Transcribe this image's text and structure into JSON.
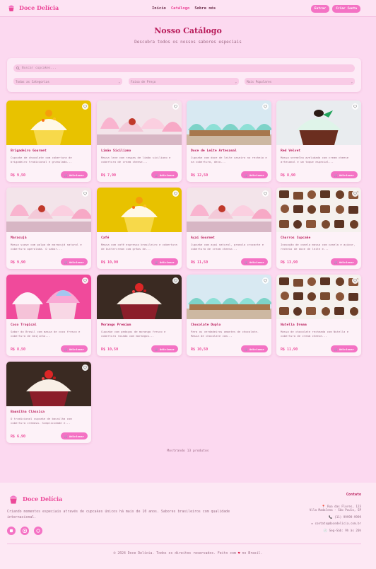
{
  "nav": {
    "brand": "Doce Delícia",
    "links": [
      "Início",
      "Catálogo",
      "Sobre nós"
    ],
    "login": "Entrar",
    "signup": "Criar Conta"
  },
  "page": {
    "title": "Nosso Catálogo",
    "subtitle": "Descubra todos os nossos sabores especiais"
  },
  "filters": {
    "search_placeholder": "Buscar cupcakes...",
    "category": "Todas as Categorias",
    "price": "Faixa de Preço",
    "sort": "Mais Populares"
  },
  "add_label": "Adicionar",
  "products": [
    {
      "name": "Brigadeiro Gourmet",
      "desc": "Cupcake de chocolate com cobertura de brigadeiro tradicional e granulado...",
      "price": "R$ 9,50",
      "img": "yellow"
    },
    {
      "name": "Limão Siciliano",
      "desc": "Massa leve com raspas de limão siciliano e cobertura de cream cheese...",
      "price": "R$ 7,90",
      "img": "pastel"
    },
    {
      "name": "Doce de Leite Artesanal",
      "desc": "Cupcake com doce de leite caseiro no recheio e na cobertura, deco...",
      "price": "R$ 12,50",
      "img": "teal"
    },
    {
      "name": "Red Velvet",
      "desc": "Massa vermelha aveludada com cream cheese artesanal e um toque especial...",
      "price": "R$ 8,90",
      "img": "velvet"
    },
    {
      "name": "Maracujá",
      "desc": "Massa suave com polpa de maracujá natural e cobertura aperolada. O sabor...",
      "price": "R$ 9,90",
      "img": "pastel"
    },
    {
      "name": "Café",
      "desc": "Massa com café espresso brasileiro e cobertura de buttercream com grãos de...",
      "price": "R$ 10,90",
      "img": "yellow"
    },
    {
      "name": "Açaí Gourmet",
      "desc": "Cupcake com açaí natural, granola crocante e cobertura de cream cheese...",
      "price": "R$ 11,50",
      "img": "pastel"
    },
    {
      "name": "Churros Cupcake",
      "desc": "Inovação de canela massa com canela e açúcar, recheio de doce de leite e...",
      "price": "R$ 13,90",
      "img": "choc"
    },
    {
      "name": "Coco Tropical",
      "desc": "Sabor do Brasil com massa de coco fresco e cobertura de beijinho...",
      "price": "R$ 8,50",
      "img": "pink"
    },
    {
      "name": "Morango Premium",
      "desc": "Cupcake com pedaços de morango fresco e cobertura rosada com morangos...",
      "price": "R$ 10,50",
      "img": "strawberry"
    },
    {
      "name": "Chocolate Duplo",
      "desc": "Para os verdadeiros amantes de chocolate. Massa de chocolate com...",
      "price": "R$ 10,50",
      "img": "teal"
    },
    {
      "name": "Nutella Dream",
      "desc": "Massa de chocolate recheada com Nutella e cobertura de cream cheese...",
      "price": "R$ 11,90",
      "img": "choc"
    },
    {
      "name": "Baunilha Clássica",
      "desc": "O tradicional cupcake de baunilha com cobertura cremosa. Simplicidade e...",
      "price": "R$ 6,90",
      "img": "strawberry"
    }
  ],
  "count_text": "Mostrando 13 produtos",
  "footer": {
    "brand": "Doce Delícia",
    "tagline": "Criando momentos especiais através de cupcakes únicos há mais de 10 anos. Sabores brasileiros com qualidade internacional.",
    "contact_title": "Contato",
    "address1": "Rua das Flores, 123",
    "address2": "Vila Madalena - São Paulo, SP",
    "phone": "(11) 99999-9999",
    "email": "contato@docedelicia.com.br",
    "hours": "Seg-Sáb: 9h às 20h",
    "copyright_pre": "© 2024 Doce Delícia. Todos os direitos reservados. Feito com",
    "copyright_post": "no Brasil."
  },
  "colors": {
    "accent": "#ec4899",
    "title": "#b91c5b",
    "background": "#fcd9f0"
  },
  "icons": {
    "heart": "heart-icon",
    "cart": "cart-icon",
    "search": "search-icon",
    "pin": "map-pin-icon",
    "phone": "phone-icon",
    "mail": "mail-icon",
    "clock": "clock-icon"
  }
}
